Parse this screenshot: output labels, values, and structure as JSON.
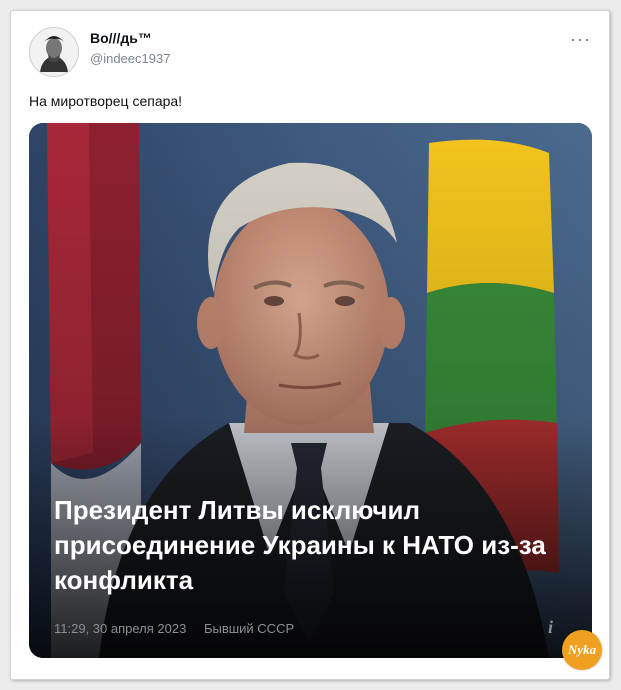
{
  "tweet": {
    "display_name": "Во///дь™",
    "handle": "@indeec1937",
    "text": "На миротворец сепара!",
    "more_icon": "more-horizontal-icon"
  },
  "media": {
    "headline": "Президент Литвы исключил присоединение Украины к НАТО из-за конфликта",
    "timestamp": "11:29, 30 апреля 2023",
    "source": "Бывший СССР",
    "info_icon": "i"
  },
  "watermark": {
    "text": "Nyka"
  },
  "colors": {
    "name": "#0f1419",
    "handle": "#7a8591",
    "headline": "#ffffff",
    "meta": "#8a8f96",
    "watermark": "#f0a020"
  }
}
